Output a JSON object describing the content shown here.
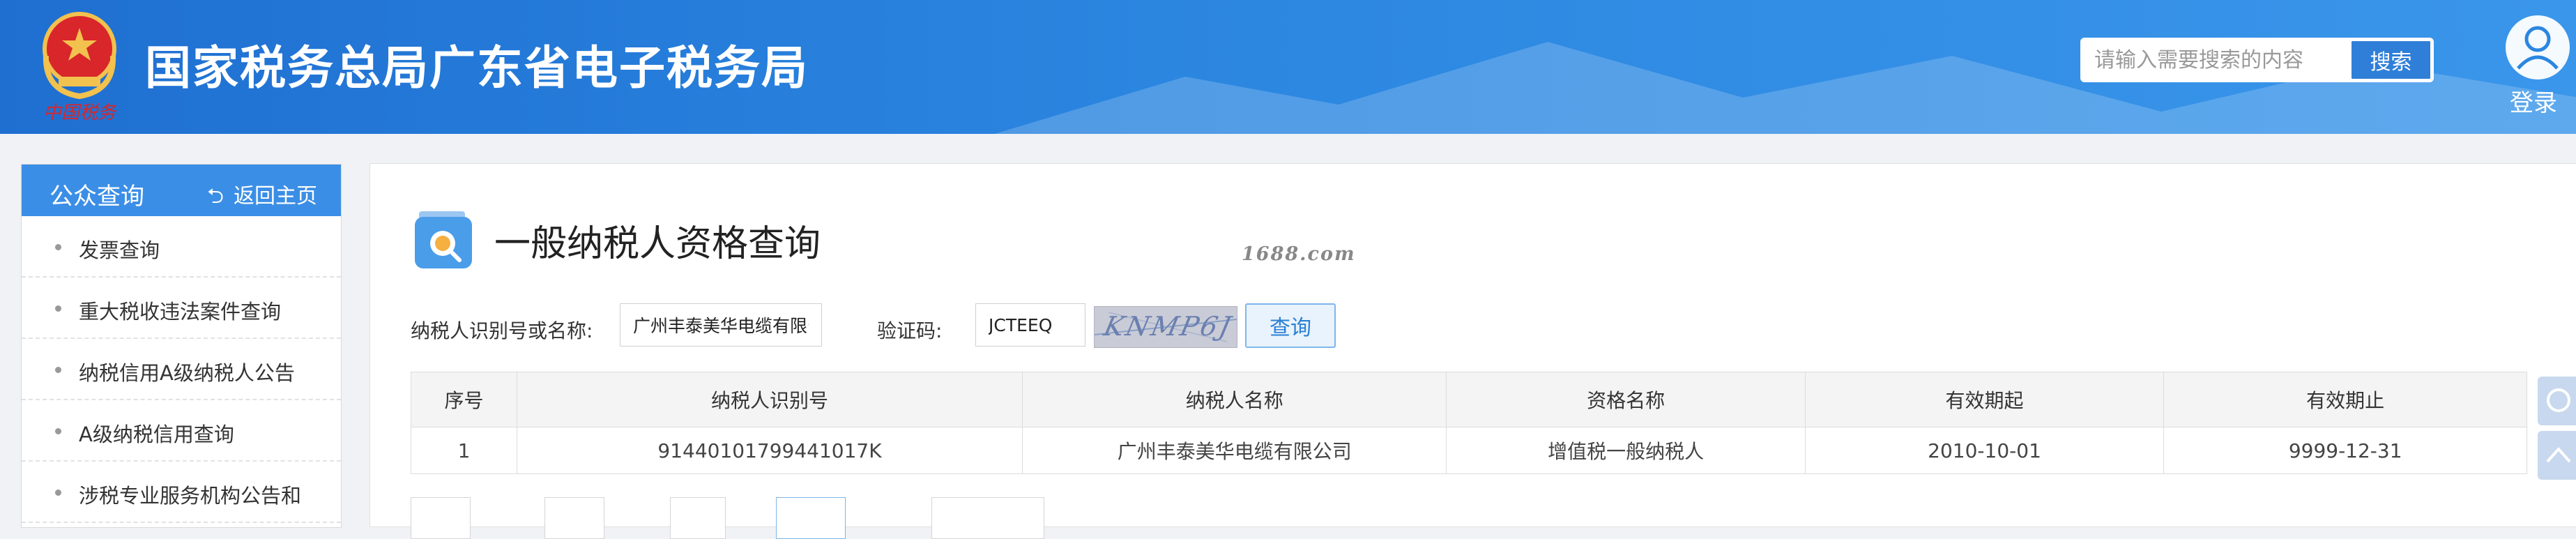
{
  "header": {
    "site_title": "国家税务总局广东省电子税务局",
    "search_placeholder": "请输入需要搜索的内容",
    "search_button": "搜索",
    "login_label": "登录",
    "emblem_icon": "national-emblem-icon",
    "colors": {
      "bar": "#2b86e0",
      "search_button": "#2f7fd8"
    }
  },
  "sidebar": {
    "title": "公众查询",
    "back_home": "返回主页",
    "items": [
      {
        "label": "发票查询"
      },
      {
        "label": "重大税收违法案件查询"
      },
      {
        "label": "纳税信用A级纳税人公告"
      },
      {
        "label": "A级纳税信用查询"
      },
      {
        "label": "涉税专业服务机构公告和"
      }
    ]
  },
  "main": {
    "title": "一般纳税人资格查询",
    "watermark": "1688.com",
    "form": {
      "taxpayer_label": "纳税人识别号或名称:",
      "taxpayer_value": "广州丰泰美华电缆有限公司",
      "captcha_label": "验证码:",
      "captcha_value": "JCTEEQ",
      "captcha_image_text": "KNMP6J",
      "query_button": "查询"
    },
    "table": {
      "headers": [
        "序号",
        "纳税人识别号",
        "纳税人名称",
        "资格名称",
        "有效期起",
        "有效期止"
      ],
      "rows": [
        [
          "1",
          "91440101799441017K",
          "广州丰泰美华电缆有限公司",
          "增值税一般纳税人",
          "2010-10-01",
          "9999-12-31"
        ]
      ]
    }
  }
}
